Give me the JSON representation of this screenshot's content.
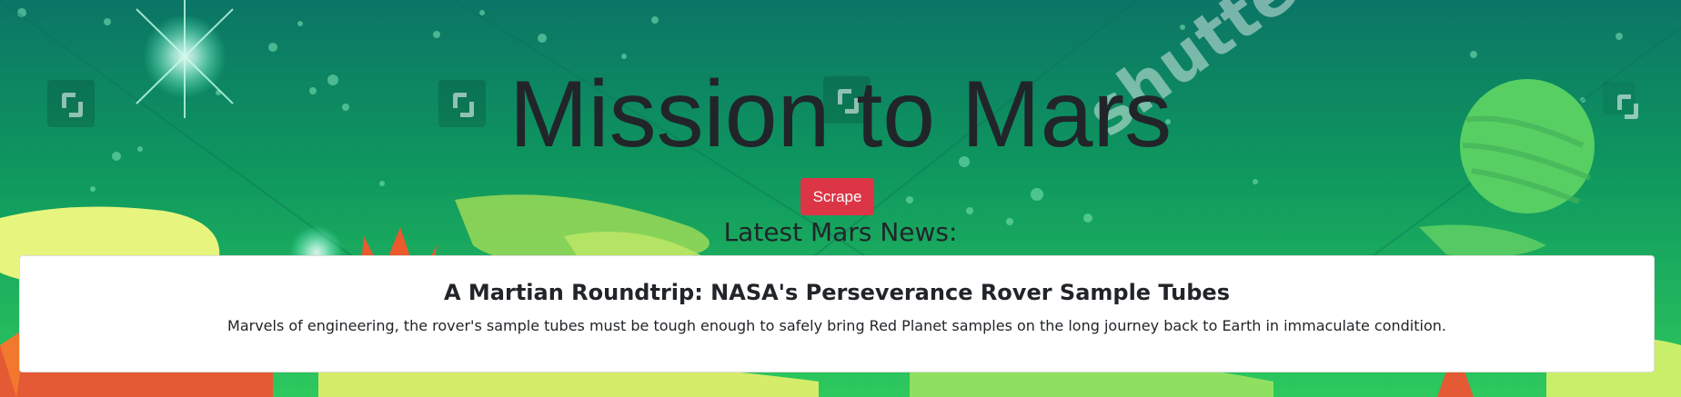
{
  "page": {
    "title": "Mission to Mars",
    "scrape_label": "Scrape",
    "news_heading": "Latest Mars News:"
  },
  "news": {
    "title": "A Martian Roundtrip: NASA's Perseverance Rover Sample Tubes",
    "paragraph": "Marvels of engineering, the rover's sample tubes must be tough enough to safely bring Red Planet samples on the long journey back to Earth in immaculate condition."
  },
  "background": {
    "watermark": "shutterstock",
    "description_icons": [
      "shutterstock-logo-icon"
    ]
  },
  "colors": {
    "accent_button": "#dc3545",
    "text": "#212529",
    "card_bg": "#ffffff"
  }
}
